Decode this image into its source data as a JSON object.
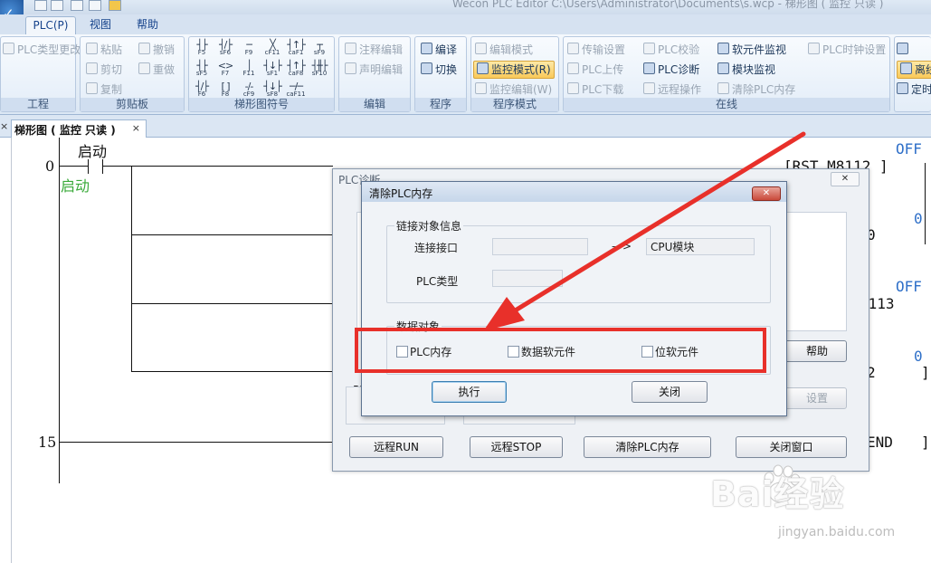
{
  "window": {
    "title": "Wecon PLC Editor   C:\\Users\\Administrator\\Documents\\s.wcp  -  梯形图 ( 监控 只读 )"
  },
  "ribbon_tabs": [
    {
      "label": "PLC(P)",
      "active": true
    },
    {
      "label": "视图",
      "active": false
    },
    {
      "label": "帮助",
      "active": false
    }
  ],
  "ribbon": {
    "project": {
      "label": "工程",
      "items": [
        "PLC类型更改"
      ]
    },
    "clipboard": {
      "label": "剪贴板",
      "items": [
        "粘贴",
        "撤销",
        "剪切",
        "重做",
        "复制"
      ]
    },
    "ladder_symbols": {
      "label": "梯形图符号",
      "symbols": [
        "F5",
        "sF6",
        "F9",
        "cF11",
        "caF1",
        "sF9",
        "sF5",
        "F7",
        "F11",
        "sF1",
        "caF8",
        "sF10",
        "F6",
        "F8",
        "cF9",
        "sF8",
        "caF11"
      ]
    },
    "edit": {
      "label": "编辑",
      "items": [
        "注释编辑",
        "声明编辑"
      ]
    },
    "program": {
      "label": "程序",
      "items": [
        "编译",
        "切换"
      ]
    },
    "program_mode": {
      "label": "程序模式",
      "items": [
        "编辑模式",
        "监控模式(R)",
        "监控编辑(W)"
      ]
    },
    "online": {
      "label": "在线",
      "items": [
        "传输设置",
        "PLC上传",
        "PLC下载",
        "PLC校验",
        "PLC诊断",
        "远程操作",
        "软元件监视",
        "模块监视",
        "清除PLC内存",
        "PLC时钟设置"
      ]
    },
    "cut": {
      "items": [
        "离线",
        "定时"
      ]
    }
  },
  "doc_tab": {
    "label": "梯形图 ( 监控 只读 )",
    "close": "×"
  },
  "ladder": {
    "rungs": [
      {
        "number": "0",
        "contact_comment": "启动",
        "contact_label": "启动",
        "coil": "[RST     M8112 ]",
        "coil_state": "OFF"
      },
      {
        "value": "0",
        "partial": "0"
      },
      {
        "state": "OFF",
        "partial": "8113"
      },
      {
        "value": "0",
        "partial": "2"
      },
      {
        "number": "15",
        "partial": "END"
      }
    ]
  },
  "diag_dialog": {
    "title": "PLC诊断",
    "close": "✕",
    "buttons": [
      "远程RUN",
      "远程STOP",
      "清除PLC内存",
      "关闭窗口"
    ],
    "partial_buttons": [
      "帮助",
      "设置"
    ],
    "partial_label": "PL"
  },
  "clear_dialog": {
    "title": "清除PLC内存",
    "close": "✕",
    "link_group": {
      "legend": "链接对象信息",
      "interface_label": "连接接口",
      "interface_value": "",
      "arrow": "—>",
      "target": "CPU模块",
      "plc_type_label": "PLC类型",
      "plc_type_value": ""
    },
    "data_group": {
      "legend": "数据对象",
      "options": [
        {
          "label": "PLC内存",
          "checked": false
        },
        {
          "label": "数据软元件",
          "checked": false
        },
        {
          "label": "位软元件",
          "checked": false
        }
      ]
    },
    "execute_button": "执行",
    "close_button": "关闭"
  },
  "annotation": {
    "color": "#e8302a"
  },
  "watermark": {
    "text": "Bai经验",
    "url": "jingyan.baidu.com"
  }
}
